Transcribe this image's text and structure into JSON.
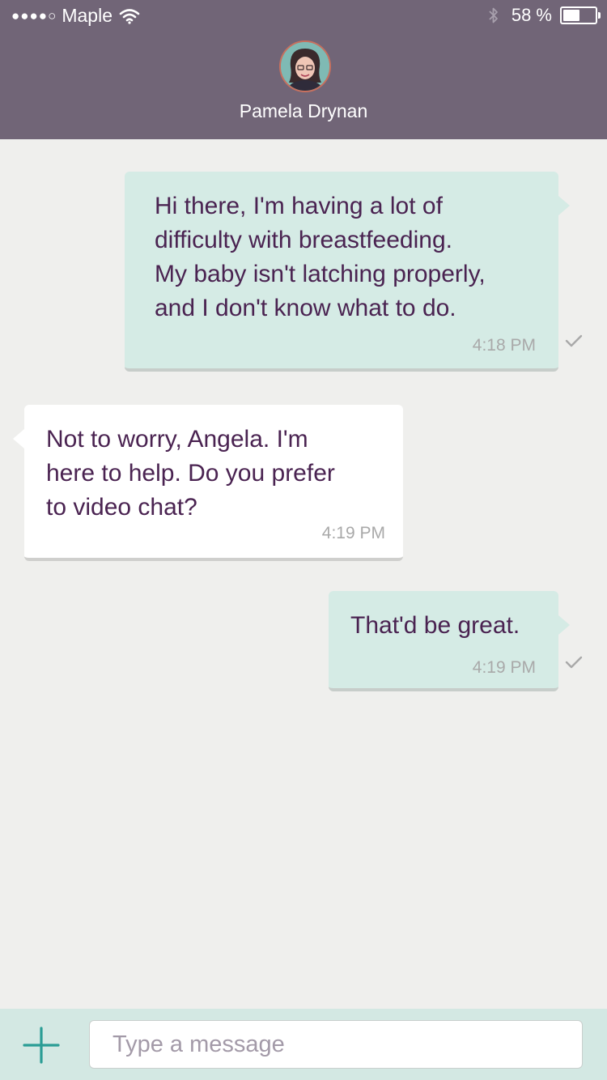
{
  "status_bar": {
    "signal_dots": "●●●●○",
    "carrier": "Maple",
    "battery_percent": "58 %",
    "battery_level": 0.58
  },
  "header": {
    "contact_name": "Pamela Drynan",
    "avatar_icon": "contact-avatar"
  },
  "messages": [
    {
      "direction": "outgoing",
      "text": "Hi there, I'm having a lot of\ndifficulty with breastfeeding.\nMy baby isn't latching properly,\nand I don't know what to do.",
      "time": "4:18 PM",
      "read_icon": "checkmark-icon"
    },
    {
      "direction": "incoming",
      "text": "Not to worry, Angela. I'm\nhere to help. Do you prefer\nto video chat?",
      "time": "4:19 PM"
    },
    {
      "direction": "outgoing",
      "text": "That'd be great.",
      "time": "4:19 PM",
      "read_icon": "checkmark-icon"
    }
  ],
  "composer": {
    "placeholder": "Type a message",
    "value": "",
    "add_icon": "plus-icon"
  },
  "colors": {
    "header_bg": "#716577",
    "outgoing_bubble": "#d5ebe5",
    "incoming_bubble": "#ffffff",
    "message_text": "#4a2351",
    "accent": "#2a9d95",
    "chat_bg": "#efefed"
  }
}
